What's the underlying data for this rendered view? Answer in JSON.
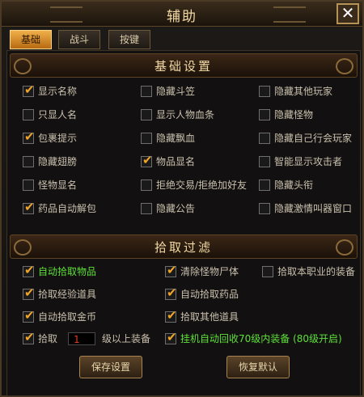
{
  "window": {
    "title": "辅助",
    "close_symbol": "✕"
  },
  "tabs": [
    {
      "label": "基础",
      "active": true
    },
    {
      "label": "战斗",
      "active": false
    },
    {
      "label": "按键",
      "active": false
    }
  ],
  "basic_settings": {
    "header": "基础设置",
    "options": [
      {
        "label": "显示名称",
        "checked": true
      },
      {
        "label": "隐藏斗笠",
        "checked": false
      },
      {
        "label": "隐藏其他玩家",
        "checked": false
      },
      {
        "label": "只显人名",
        "checked": false
      },
      {
        "label": "显示人物血条",
        "checked": false
      },
      {
        "label": "隐藏怪物",
        "checked": false
      },
      {
        "label": "包裹提示",
        "checked": true
      },
      {
        "label": "隐藏飘血",
        "checked": false
      },
      {
        "label": "隐藏自己行会玩家",
        "checked": false
      },
      {
        "label": "隐藏翅膀",
        "checked": false
      },
      {
        "label": "物品显名",
        "checked": true
      },
      {
        "label": "智能显示攻击者",
        "checked": false
      },
      {
        "label": "怪物显名",
        "checked": false
      },
      {
        "label": "拒绝交易/拒绝加好友",
        "checked": false
      },
      {
        "label": "隐藏头衔",
        "checked": false
      },
      {
        "label": "药品自动解包",
        "checked": true
      },
      {
        "label": "隐藏公告",
        "checked": false
      },
      {
        "label": "隐藏激情叫器窗口",
        "checked": false
      }
    ]
  },
  "pickup_filter": {
    "header": "拾取过滤",
    "options": [
      {
        "label": "自动拾取物品",
        "checked": true,
        "highlight": true
      },
      {
        "label": "清除怪物尸体",
        "checked": true,
        "highlight": false
      },
      {
        "label": "拾取本职业的装备",
        "checked": false,
        "highlight": false
      },
      {
        "label": "拾取经验道具",
        "checked": true,
        "highlight": false
      },
      {
        "label": "自动拾取药品",
        "checked": true,
        "highlight": false
      },
      {
        "label": "自动拾取金币",
        "checked": true,
        "highlight": false
      },
      {
        "label": "拾取其他道具",
        "checked": true,
        "highlight": false
      }
    ],
    "level_row": {
      "prefix": "拾取",
      "checked": true,
      "value": "1",
      "suffix": "级以上装备"
    },
    "recycle": {
      "label": "挂机自动回收70级内装备 (80级开启)",
      "checked": true,
      "highlight": true
    }
  },
  "buttons": {
    "save": "保存设置",
    "reset": "恢复默认"
  },
  "colors": {
    "accent": "#f0a52a",
    "highlight_text": "#5ee13a",
    "title_text": "#f2d9a4"
  }
}
